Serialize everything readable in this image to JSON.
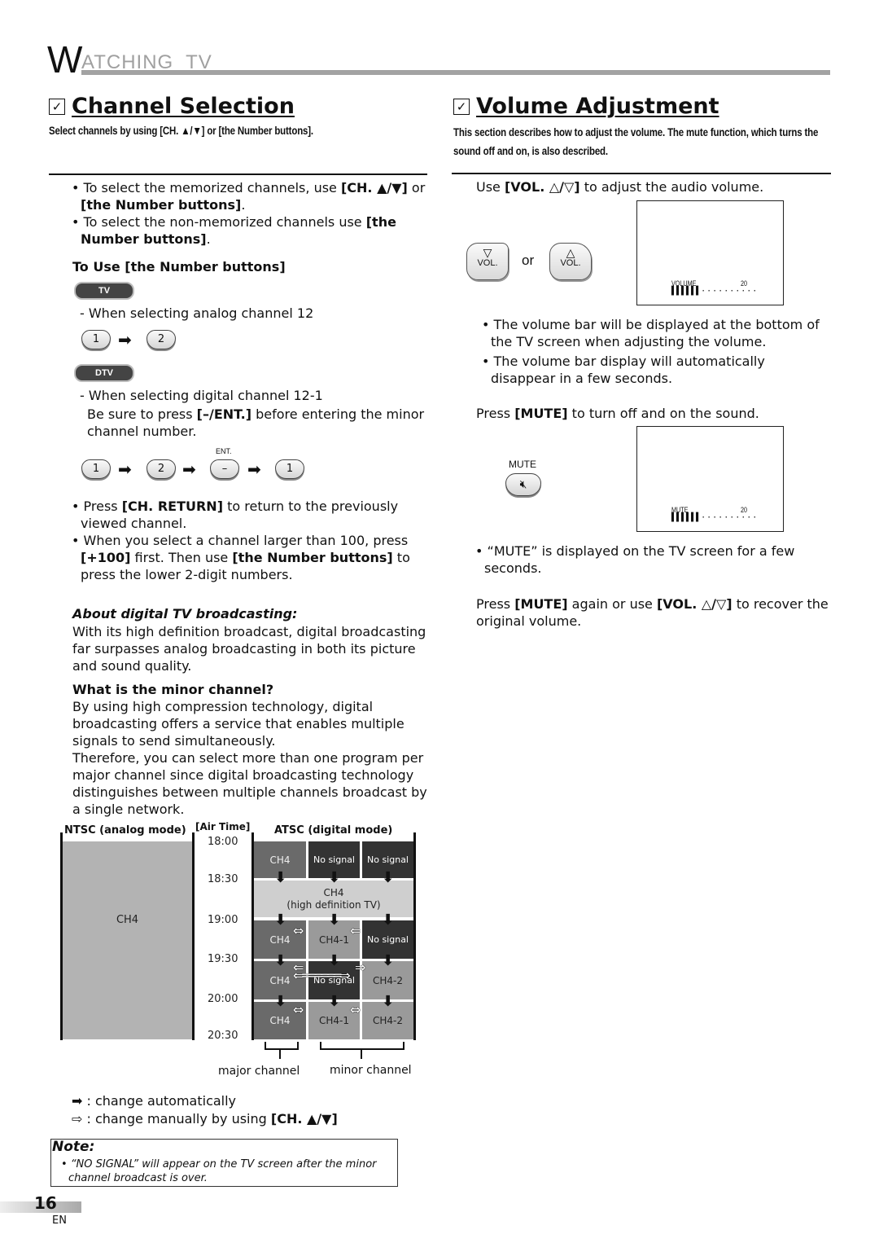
{
  "header": {
    "initial": "W",
    "rest": "ATCHING  TV"
  },
  "channel_selection": {
    "title": "Channel Selection",
    "subtitle": "Select channels by using [CH. ▲/▼] or [the Number buttons].",
    "bullets": [
      {
        "pre": "To select the memorized channels, use ",
        "bold1": "[CH. ▲/▼]",
        "mid": " or ",
        "bold2": "[the Number buttons]",
        "post": "."
      },
      {
        "pre": "To select the non-memorized channels use ",
        "bold1": "[the Number buttons]",
        "post": "."
      }
    ],
    "number_heading": "To Use [the Number buttons]",
    "tv_pill": "TV",
    "analog_caption": "- When selecting analog channel 12",
    "analog_keys": [
      "1",
      "2"
    ],
    "dtv_pill": "DTV",
    "digital_caption": "- When selecting digital channel 12-1",
    "digital_note_pre": "Be sure to press ",
    "digital_note_bold": "[–/ENT.]",
    "digital_note_post": " before entering the minor channel number.",
    "ent_label": "ENT.",
    "digital_keys": [
      "1",
      "2",
      "–",
      "1"
    ],
    "bullets2": [
      {
        "pre": "Press ",
        "bold1": "[CH. RETURN]",
        "post": " to return to the previously viewed channel."
      },
      {
        "pre": "When you select a channel larger than 100, press ",
        "bold1": "[+100]",
        "mid": " first. Then use ",
        "bold2": "[the Number buttons]",
        "post": " to press the lower 2-digit numbers."
      }
    ],
    "about_heading": "About digital TV broadcasting:",
    "about_text": "With its high definition broadcast, digital broadcasting far surpasses analog broadcasting in both its picture and sound quality.",
    "minor_heading": "What is the minor channel?",
    "minor_text1": "By using high compression technology, digital broadcasting offers a service that enables multiple signals to send simultaneously.",
    "minor_text2": "Therefore, you can select more than one program per major channel since digital broadcasting technology distinguishes between multiple channels broadcast by a single network."
  },
  "diagram": {
    "ntsc_label": "NTSC (analog mode)",
    "airtime_label": "[Air Time]",
    "atsc_label": "ATSC (digital mode)",
    "ntsc_channel": "CH4",
    "times": [
      "18:00",
      "18:30",
      "19:00",
      "19:30",
      "20:00",
      "20:30"
    ],
    "rows": [
      [
        "CH4",
        "No signal",
        "No signal"
      ],
      [
        "CH4",
        "(high definition TV)"
      ],
      [
        "CH4",
        "CH4-1",
        "No signal"
      ],
      [
        "CH4",
        "No signal",
        "CH4-2"
      ],
      [
        "CH4",
        "CH4-1",
        "CH4-2"
      ]
    ],
    "major_label": "major channel",
    "minor_label": "minor channel",
    "legend_auto": ": change automatically",
    "legend_manual_pre": ": change manually by using ",
    "legend_manual_bold": "[CH. ▲/▼]"
  },
  "note": {
    "title": "Note:",
    "text": "“NO SIGNAL” will appear on the TV screen after the minor channel broadcast is over."
  },
  "footer": {
    "page_number": "16",
    "lang": "EN"
  },
  "volume_adjustment": {
    "title": "Volume Adjustment",
    "subtitle": "This section describes how to adjust the volume. The mute function, which turns the sound off and on, is also described.",
    "use_pre": "Use ",
    "use_bold": "[VOL. △/▽]",
    "use_post": " to adjust the audio volume.",
    "vol_down_label": "VOL.",
    "or_label": "or",
    "vol_up_label": "VOL.",
    "osd_volume_label": "VOLUME",
    "osd_volume_value": "20",
    "bullets": [
      "The volume bar will be displayed at the bottom of the TV screen when adjusting the volume.",
      "The volume bar display will automatically disappear in a few seconds."
    ],
    "mute_pre": "Press ",
    "mute_bold": "[MUTE]",
    "mute_post": " to turn off and on the sound.",
    "mute_button_label": "MUTE",
    "osd_mute_label": "MUTE",
    "osd_mute_value": "20",
    "mute_bullet": "“MUTE” is displayed on the TV screen for a few seconds.",
    "recover_pre": "Press ",
    "recover_bold1": "[MUTE]",
    "recover_mid": " again or use ",
    "recover_bold2": "[VOL. △/▽]",
    "recover_post": " to recover the original volume."
  }
}
